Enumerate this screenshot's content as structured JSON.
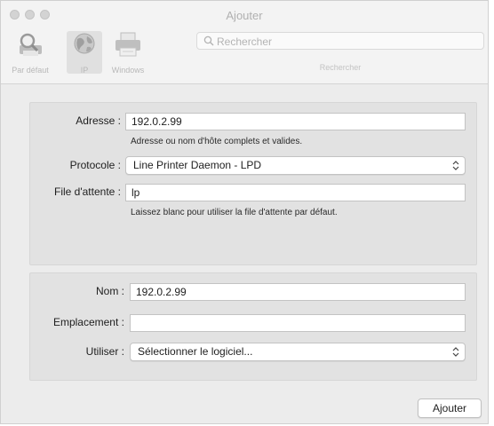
{
  "window": {
    "title": "Ajouter"
  },
  "toolbar": {
    "items": [
      {
        "label": "Par défaut",
        "icon": "magnifier-printer-icon"
      },
      {
        "label": "IP",
        "icon": "globe-icon"
      },
      {
        "label": "Windows",
        "icon": "printer-icon"
      }
    ],
    "selected": "IP"
  },
  "search": {
    "placeholder": "Rechercher",
    "caption": "Rechercher"
  },
  "printer": {
    "address_label": "Adresse :",
    "address_value": "192.0.2.99",
    "address_hint": "Adresse ou nom d'hôte complets et valides.",
    "protocol_label": "Protocole :",
    "protocol_value": "Line Printer Daemon - LPD",
    "queue_label": "File d'attente :",
    "queue_value": "lp",
    "queue_hint": "Laissez blanc pour utiliser la file d'attente par défaut."
  },
  "details": {
    "name_label": "Nom :",
    "name_value": "192.0.2.99",
    "location_label": "Emplacement :",
    "location_value": "",
    "use_label": "Utiliser :",
    "use_value": "Sélectionner le logiciel..."
  },
  "actions": {
    "add_label": "Ajouter"
  },
  "colors": {
    "window_bg": "#ececec",
    "panel_bg": "#e2e2e2",
    "field_border": "#c3c3c3"
  }
}
